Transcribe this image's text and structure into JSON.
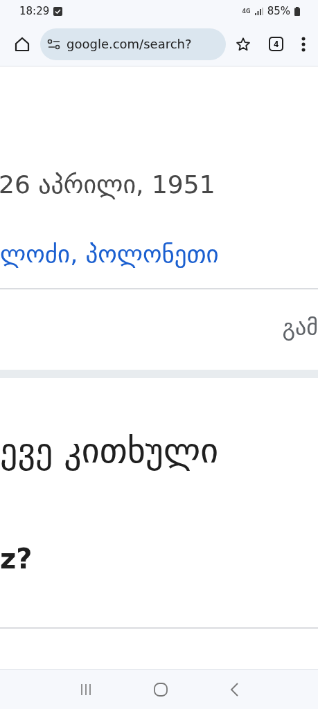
{
  "status_bar": {
    "time": "18:29",
    "network": "4G",
    "battery": "85%"
  },
  "toolbar": {
    "url": "google.com/search?",
    "tab_count": "4"
  },
  "content": {
    "date": "26 აპრილი, 1951",
    "place_link": "ლოძი, პოლონეთი",
    "more": "გამ",
    "heading": "ევე კითხული",
    "question": "z?"
  }
}
